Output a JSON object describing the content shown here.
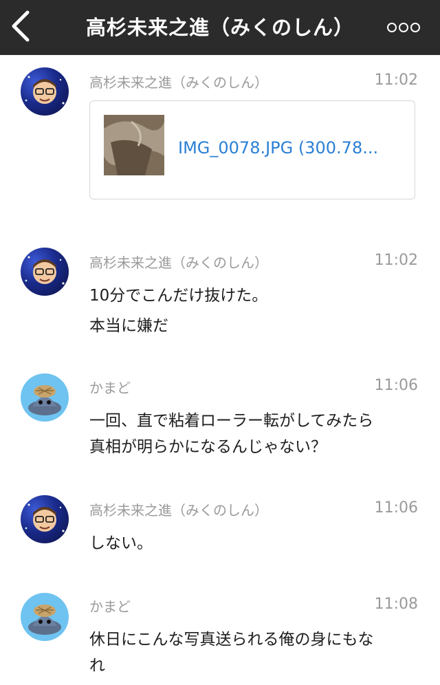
{
  "header": {
    "title": "高杉未来之進（みくのしん）",
    "back_icon": "chevron-left-icon",
    "more_icon": "more-dots-icon"
  },
  "messages": [
    {
      "sender": "高杉未来之進（みくのしん）",
      "time": "11:02",
      "avatar": "galaxy-avatar",
      "file": {
        "name": "IMG_0078.JPG (300.78..."
      }
    },
    {
      "sender": "高杉未来之進（みくのしん）",
      "time": "11:02",
      "avatar": "galaxy-avatar",
      "lines": [
        "10分でこんだけ抜けた。",
        "本当に嫌だ"
      ]
    },
    {
      "sender": "かまど",
      "time": "11:06",
      "avatar": "mascot-avatar",
      "lines": [
        "一回、直で粘着ローラー転がしてみたら",
        "真相が明らかになるんじゃない？"
      ]
    },
    {
      "sender": "高杉未来之進（みくのしん）",
      "time": "11:06",
      "avatar": "galaxy-avatar",
      "lines": [
        "しない。"
      ]
    },
    {
      "sender": "かまど",
      "time": "11:08",
      "avatar": "mascot-avatar",
      "lines": [
        "休日にこんな写真送られる俺の身にもな",
        "れ"
      ]
    }
  ],
  "colors": {
    "header_bg": "#2b2b2b",
    "link": "#2a7fd4",
    "meta": "#9a9a9a"
  }
}
